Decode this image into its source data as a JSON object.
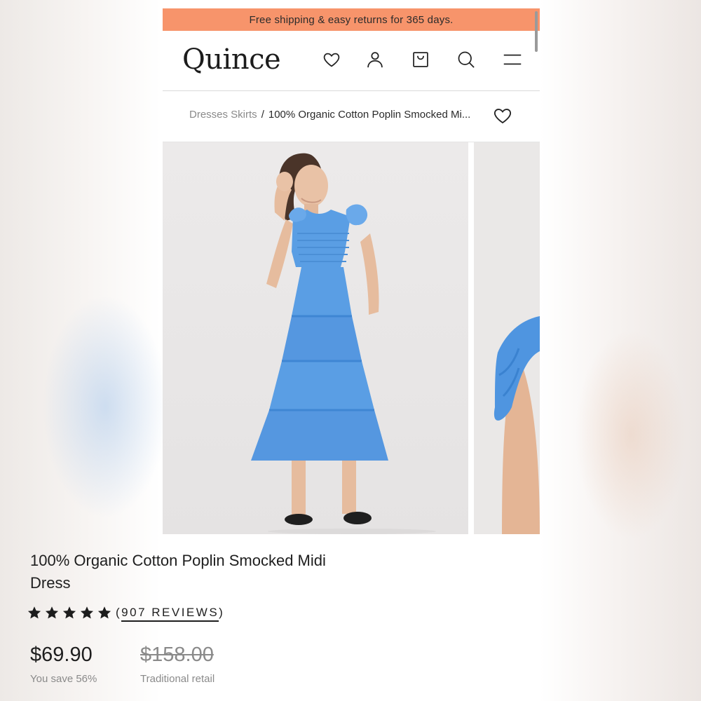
{
  "promo": {
    "text": "Free shipping & easy returns for 365 days."
  },
  "header": {
    "logo": "Quince",
    "icons": [
      "heart-icon",
      "user-icon",
      "shopping-bag-icon",
      "search-icon",
      "menu-icon"
    ]
  },
  "breadcrumb": {
    "parent": "Dresses Skirts",
    "separator": "/",
    "current": "100% Organic Cotton Poplin Smocked Mi..."
  },
  "gallery": {
    "images": [
      "product-photo-model-front",
      "product-photo-shoulder-detail"
    ],
    "dress_color": "#5a9ee4"
  },
  "product": {
    "title": "100% Organic Cotton Poplin Smocked Midi Dress",
    "rating": 5,
    "reviews_open": "(",
    "reviews_label": "907 REVIEWS",
    "reviews_close": ")",
    "price": "$69.90",
    "savings": "You save 56%",
    "retail_price": "$158.00",
    "retail_label": "Traditional retail"
  },
  "colors": {
    "promo_bg": "#f7946b",
    "text": "#1e1e1e",
    "muted": "#8a8a8a"
  }
}
